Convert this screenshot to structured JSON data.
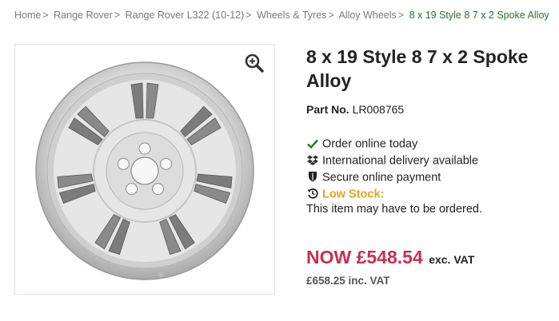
{
  "breadcrumb": {
    "items": [
      "Home",
      "Range Rover",
      "Range Rover L322 (10-12)",
      "Wheels & Tyres",
      "Alloy Wheels"
    ],
    "separator": ">",
    "current": "8 x 19 Style 8 7 x 2 Spoke Alloy"
  },
  "product": {
    "title": "8 x 19 Style 8 7 x 2 Spoke Alloy",
    "part_label": "Part No.",
    "part_number": "LR008765"
  },
  "features": [
    {
      "icon": "check-icon",
      "text": "Order online today"
    },
    {
      "icon": "dropbox-icon",
      "text": "International delivery available"
    },
    {
      "icon": "shield-icon",
      "text": "Secure online payment"
    },
    {
      "icon": "history-icon",
      "text": "Low Stock:"
    }
  ],
  "stock_note": "This item may have to be ordered.",
  "pricing": {
    "now_price": "NOW £548.54",
    "ex_vat": "exc. VAT",
    "inc_vat_price": "£658.25 inc. VAT"
  },
  "colors": {
    "breadcrumb_current": "#2e6b3a",
    "check_green": "#2e7d32",
    "low_stock": "#e0a321",
    "price_red": "#c8304f"
  }
}
